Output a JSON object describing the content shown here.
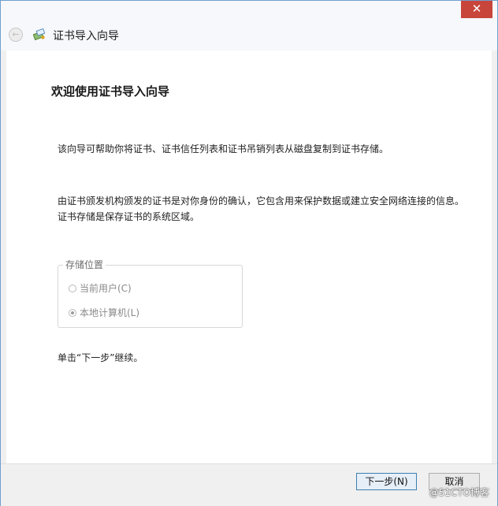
{
  "window": {
    "close_glyph": "✕",
    "title": "证书导入向导"
  },
  "icons": {
    "back": "back-arrow-icon",
    "wizard": "certificate-icon",
    "close": "close-icon"
  },
  "content": {
    "heading": "欢迎使用证书导入向导",
    "para1": "该向导可帮助你将证书、证书信任列表和证书吊销列表从磁盘复制到证书存储。",
    "para2": "由证书颁发机构颁发的证书是对你身份的确认，它包含用来保护数据或建立安全网络连接的信息。证书存储是保存证书的系统区域。",
    "store_location": {
      "title": "存储位置",
      "options": [
        {
          "label": "当前用户(C)",
          "selected": false
        },
        {
          "label": "本地计算机(L)",
          "selected": true
        }
      ]
    },
    "footer_text": "单击“下一步”继续。"
  },
  "buttons": {
    "next": "下一步(N)",
    "cancel": "取消"
  },
  "watermark": "@51CTO博客"
}
